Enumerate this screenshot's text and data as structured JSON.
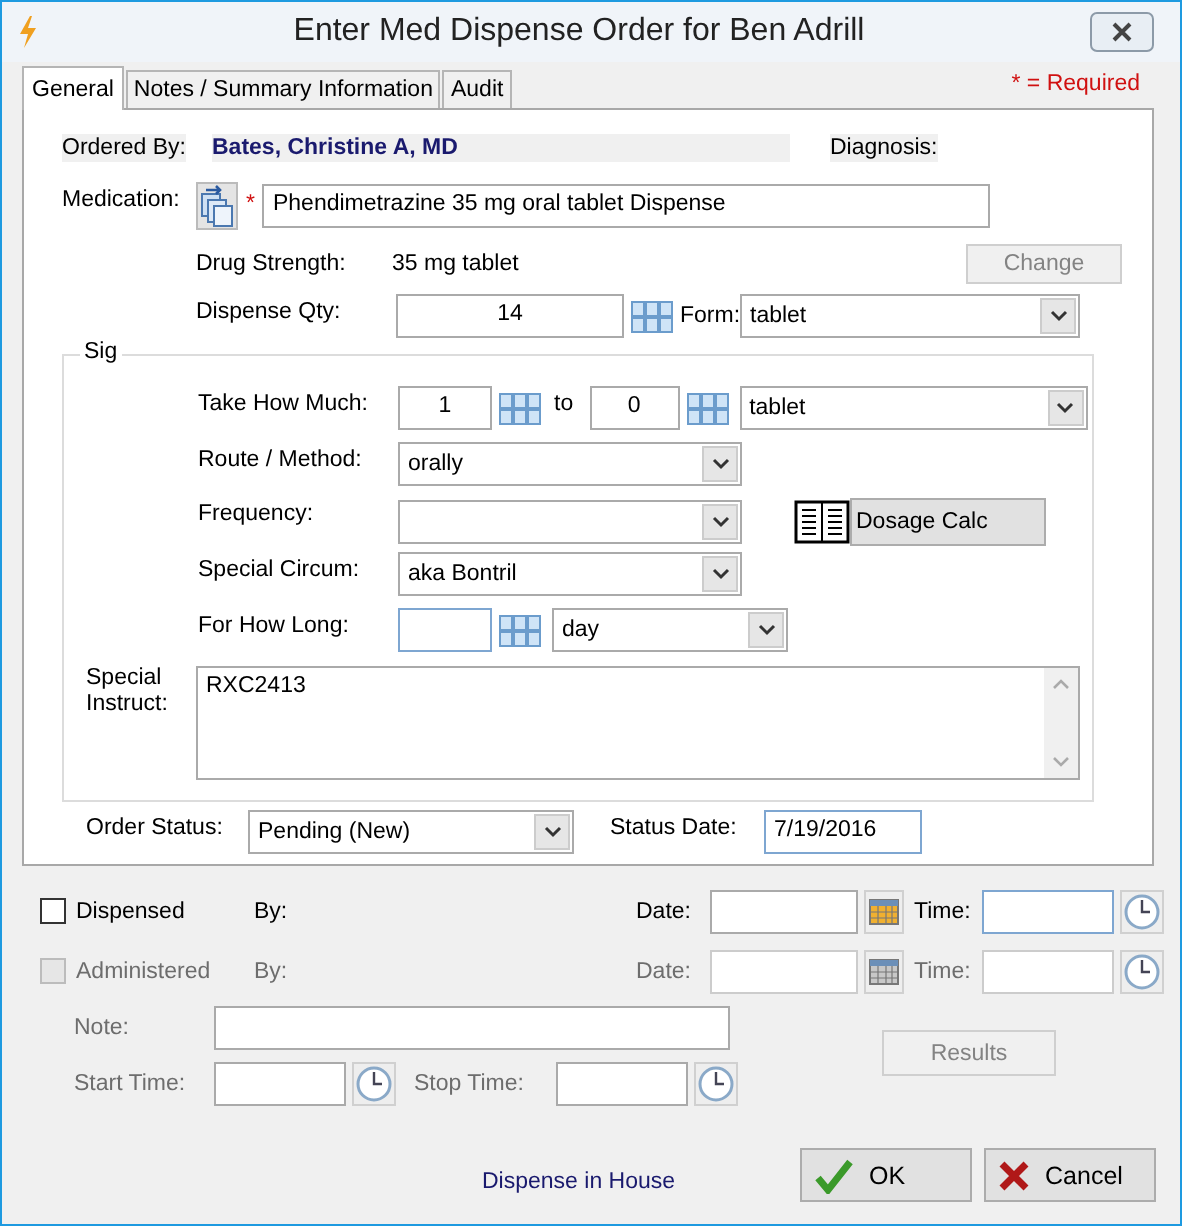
{
  "window": {
    "title": "Enter Med Dispense Order for Ben Adrill"
  },
  "required_note": "* = Required",
  "tabs": [
    {
      "label": "General",
      "selected": true
    },
    {
      "label": "Notes / Summary Information",
      "selected": false
    },
    {
      "label": "Audit",
      "selected": false
    }
  ],
  "general": {
    "ordered_by": {
      "label": "Ordered By:",
      "value": "Bates, Christine A, MD"
    },
    "diagnosis": {
      "label": "Diagnosis:"
    },
    "medication": {
      "label": "Medication:",
      "required_mark": "*",
      "value": "Phendimetrazine 35 mg oral tablet Dispense"
    },
    "drug_strength": {
      "label": "Drug Strength:",
      "value": "35 mg tablet"
    },
    "change_button": {
      "label": "Change",
      "disabled": true
    },
    "dispense_qty": {
      "label": "Dispense Qty:",
      "value": "14"
    },
    "form": {
      "label": "Form:",
      "value": "tablet"
    },
    "sig": {
      "title": "Sig",
      "take_how_much": {
        "label": "Take How Much:",
        "from": "1",
        "to_label": "to",
        "to": "0",
        "unit": "tablet"
      },
      "route": {
        "label": "Route / Method:",
        "value": "orally"
      },
      "frequency": {
        "label": "Frequency:"
      },
      "dosage_calc_button": {
        "label": "Dosage Calc"
      },
      "special_circum": {
        "label": "Special Circum:",
        "value": "aka Bontril"
      },
      "for_how_long": {
        "label": "For How Long:",
        "unit": "day"
      },
      "special_instruct": {
        "label": "Special Instruct:",
        "value": "RXC2413"
      }
    },
    "order_status": {
      "label": "Order Status:",
      "value": "Pending (New)"
    },
    "status_date": {
      "label": "Status Date:",
      "value": "7/19/2016"
    }
  },
  "events": [
    {
      "label": "Dispensed",
      "checked": false,
      "disabled": false,
      "by_label": "By:",
      "date_label": "Date:",
      "time_label": "Time:"
    },
    {
      "label": "Administered",
      "checked": false,
      "disabled": true,
      "by_label": "By:",
      "date_label": "Date:",
      "time_label": "Time:"
    }
  ],
  "note": {
    "label": "Note:",
    "disabled": true
  },
  "results_button": {
    "label": "Results",
    "disabled": true
  },
  "start_time": {
    "label": "Start Time:",
    "disabled": true
  },
  "stop_time": {
    "label": "Stop Time:",
    "disabled": true
  },
  "dispense_link": "Dispense in House",
  "buttons": [
    {
      "label": "OK",
      "kind": "ok"
    },
    {
      "label": "Cancel",
      "kind": "cancel"
    }
  ]
}
